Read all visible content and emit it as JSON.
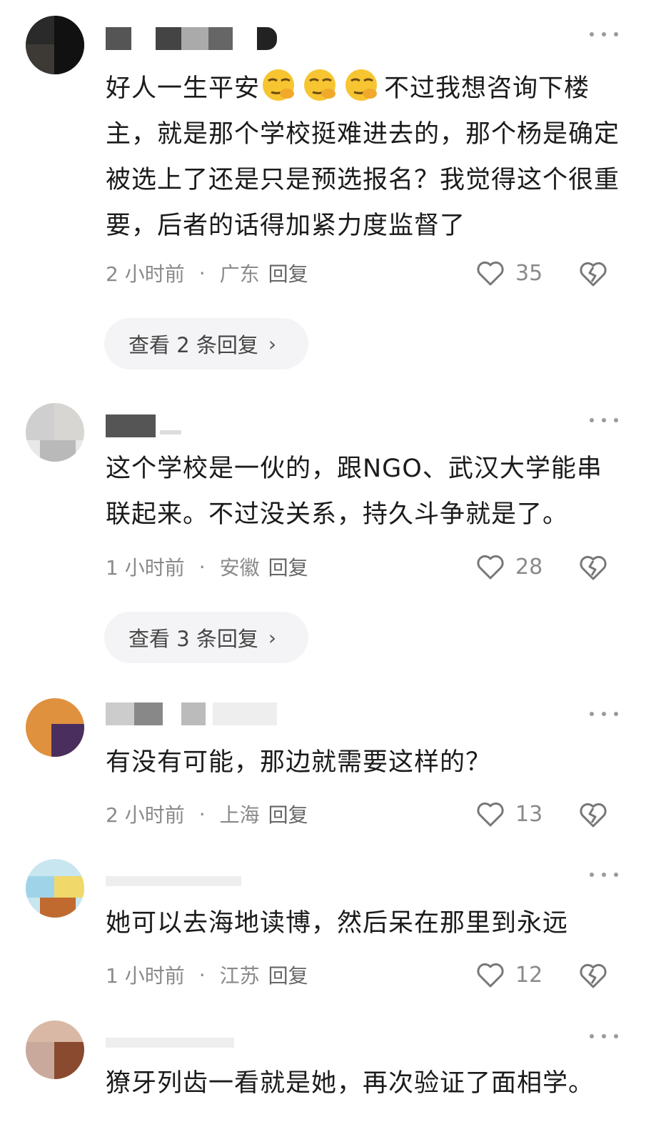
{
  "comments": [
    {
      "text": "不过我想咨询下楼主，就是那个学校挺难进去的，那个杨是确定被选上了还是只是预选报名？我觉得这个很重要，后者的话得加紧力度监督了",
      "prefix": "好人一生平安",
      "time": "2 小时前",
      "location": "广东",
      "reply_label": "回复",
      "likes": "35",
      "replies_label": "查看 2 条回复"
    },
    {
      "text": "这个学校是一伙的，跟NGO、武汉大学能串联起来。不过没关系，持久斗争就是了。",
      "time": "1 小时前",
      "location": "安徽",
      "reply_label": "回复",
      "likes": "28",
      "replies_label": "查看 3 条回复"
    },
    {
      "text": "有没有可能，那边就需要这样的？",
      "time": "2 小时前",
      "location": "上海",
      "reply_label": "回复",
      "likes": "13"
    },
    {
      "text": "她可以去海地读博，然后呆在那里到永远",
      "time": "1 小时前",
      "location": "江苏",
      "reply_label": "回复",
      "likes": "12"
    },
    {
      "text": "獠牙列齿一看就是她，再次验证了面相学。"
    }
  ],
  "icons": {
    "like": "heart-outline-icon",
    "dislike": "broken-heart-icon",
    "more": "more-dots-icon",
    "emoji": "smirk-emoji-icon"
  },
  "separator_dot": "·",
  "chevron": "›"
}
